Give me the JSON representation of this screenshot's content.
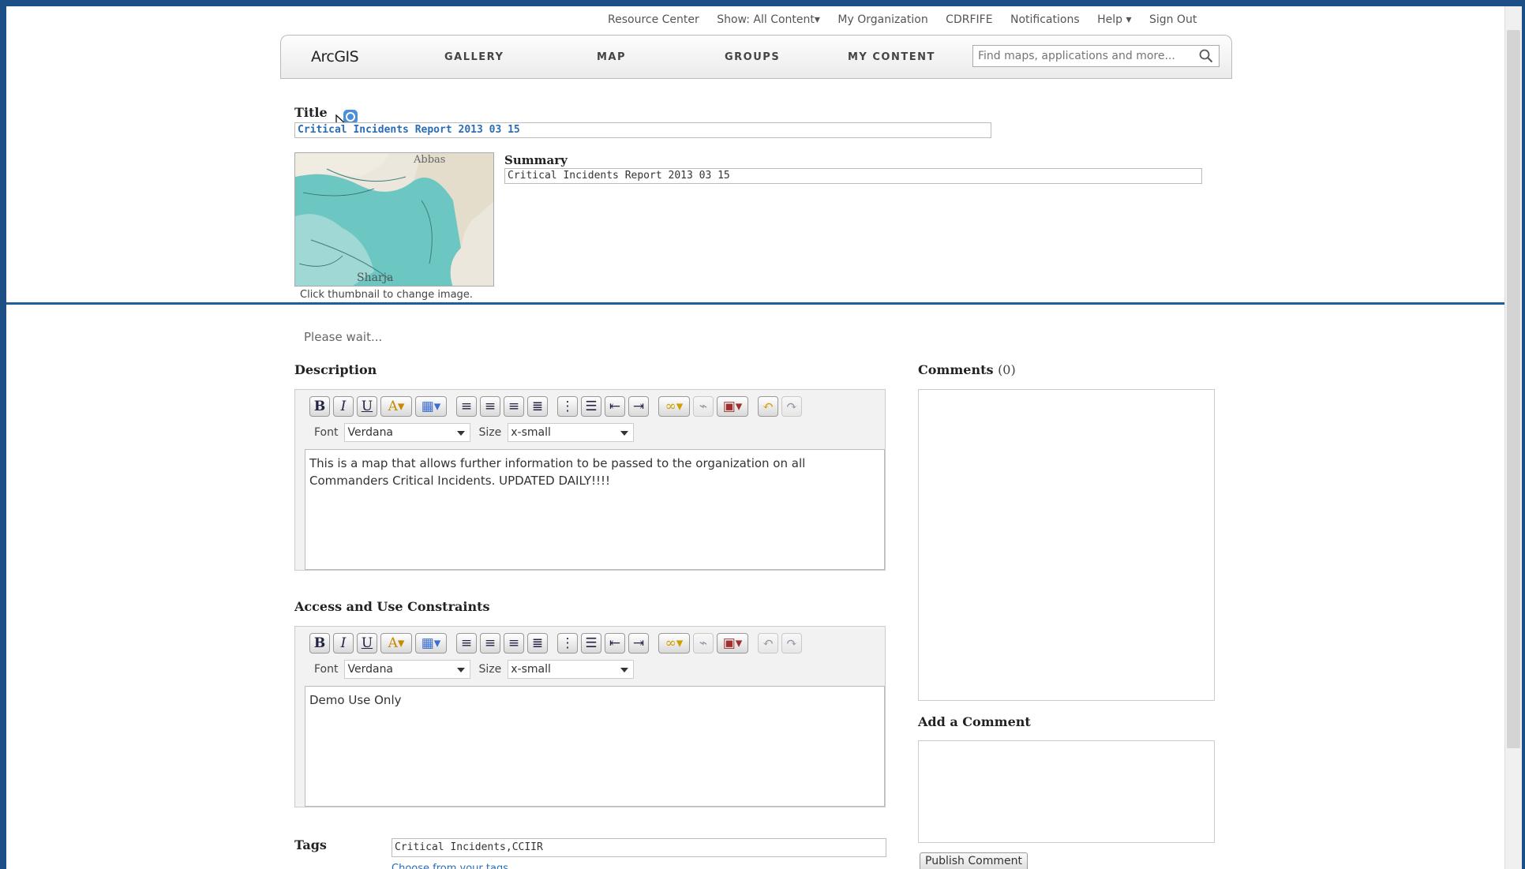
{
  "topbar": {
    "items": [
      "Resource Center",
      "Show: All Content▾",
      "My Organization",
      "CDRFIFE",
      "Notifications",
      "Help ▾",
      "Sign Out"
    ]
  },
  "navbar": {
    "logo": "ArcGIS",
    "items": [
      "GALLERY",
      "MAP",
      "GROUPS",
      "MY CONTENT"
    ],
    "search_placeholder": "Find maps, applications and more..."
  },
  "item": {
    "title_label": "Title",
    "title_value": "Critical Incidents Report 2013 03 15",
    "summary_label": "Summary",
    "summary_value": "Critical Incidents Report 2013 03 15",
    "thumbnail_caption": "Click thumbnail to change image.",
    "thumbnail_labels": [
      "Abbas",
      "Sharja"
    ]
  },
  "status": {
    "please_wait": "Please wait..."
  },
  "description": {
    "label": "Description",
    "font_label": "Font",
    "font_value": "Verdana",
    "size_label": "Size",
    "size_value": "x-small",
    "text": "This is a map that allows further information to be passed to the organization on all Commanders Critical Incidents. UPDATED DAILY!!!!"
  },
  "constraints": {
    "label": "Access and Use Constraints",
    "font_label": "Font",
    "font_value": "Verdana",
    "size_label": "Size",
    "size_value": "x-small",
    "text": "Demo Use Only"
  },
  "comments": {
    "label": "Comments",
    "count": "(0)",
    "add_label": "Add a Comment",
    "publish_button": "Publish Comment"
  },
  "tags": {
    "label": "Tags",
    "value": "Critical Incidents,CCIIR",
    "choose_link": "Choose from your tags"
  },
  "toolbar_icons": [
    "bold-icon",
    "italic-icon",
    "underline-icon",
    "font-color-icon",
    "highlight-icon",
    "align-left-icon",
    "align-center-icon",
    "align-right-icon",
    "justify-icon",
    "numbered-list-icon",
    "bullet-list-icon",
    "outdent-icon",
    "indent-icon",
    "link-icon",
    "unlink-icon",
    "insert-image-icon",
    "undo-icon",
    "redo-icon"
  ],
  "colors": {
    "frame": "#1c4f86",
    "water": "#6cc6c2",
    "link": "#2a6db5"
  }
}
